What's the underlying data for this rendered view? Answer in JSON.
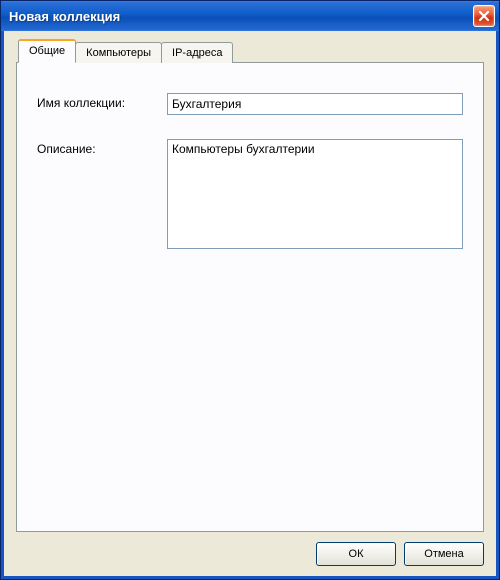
{
  "window": {
    "title": "Новая коллекция"
  },
  "tabs": {
    "general": "Общие",
    "computers": "Компьютеры",
    "ip": "IP-адреса"
  },
  "form": {
    "name_label": "Имя коллекции:",
    "name_value": "Бухгалтерия",
    "desc_label": "Описание:",
    "desc_value": "Компьютеры бухгалтерии"
  },
  "buttons": {
    "ok": "ОК",
    "cancel": "Отмена"
  }
}
